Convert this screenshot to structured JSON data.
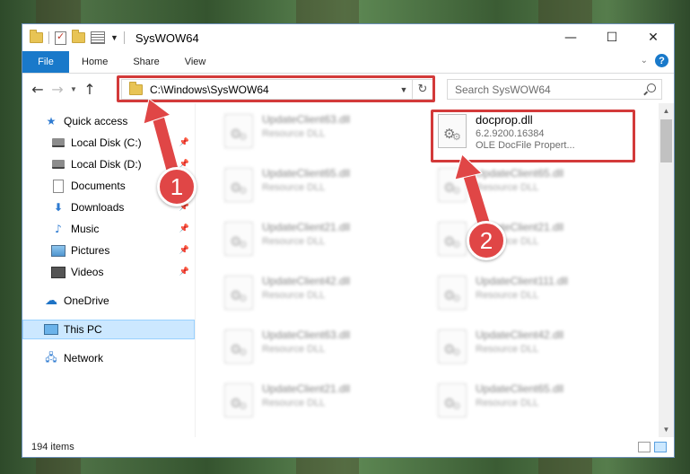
{
  "window": {
    "title": "SysWOW64",
    "controls": [
      "—",
      "☐",
      "✕"
    ]
  },
  "ribbon": {
    "tabs": [
      "File",
      "Home",
      "Share",
      "View"
    ],
    "help": "?"
  },
  "address": {
    "path": "C:\\Windows\\SysWOW64",
    "search_placeholder": "Search SysWOW64"
  },
  "sidebar": {
    "items": [
      {
        "label": "Quick access",
        "icon": "star-icon",
        "pinned": false
      },
      {
        "label": "Local Disk (C:)",
        "icon": "disk-icon",
        "pinned": true
      },
      {
        "label": "Local Disk (D:)",
        "icon": "disk-icon",
        "pinned": true
      },
      {
        "label": "Documents",
        "icon": "document-icon",
        "pinned": true
      },
      {
        "label": "Downloads",
        "icon": "download-icon",
        "pinned": true
      },
      {
        "label": "Music",
        "icon": "music-icon",
        "pinned": true
      },
      {
        "label": "Pictures",
        "icon": "pictures-icon",
        "pinned": true
      },
      {
        "label": "Videos",
        "icon": "video-icon",
        "pinned": true
      },
      {
        "label": "OneDrive",
        "icon": "cloud-icon",
        "pinned": false
      },
      {
        "label": "This PC",
        "icon": "computer-icon",
        "pinned": false,
        "selected": true
      },
      {
        "label": "Network",
        "icon": "network-icon",
        "pinned": false
      }
    ]
  },
  "files": {
    "left_column": [
      {
        "name": "UpdateClient63.dll",
        "type": "Resource DLL"
      },
      {
        "name": "UpdateClient65.dll",
        "type": "Resource DLL"
      },
      {
        "name": "UpdateClient21.dll",
        "type": "Resource DLL"
      },
      {
        "name": "UpdateClient42.dll",
        "type": "Resource DLL"
      },
      {
        "name": "UpdateClient63.dll",
        "type": "Resource DLL"
      },
      {
        "name": "UpdateClient21.dll",
        "type": "Resource DLL"
      }
    ],
    "highlighted": {
      "name": "docprop.dll",
      "version": "6.2.9200.16384",
      "description": "OLE DocFile Propert..."
    },
    "right_column": [
      {
        "name": "UpdateClient65.dll",
        "type": "Resource DLL"
      },
      {
        "name": "UpdateClient21.dll",
        "type": "Resource DLL"
      },
      {
        "name": "UpdateClient111.dll",
        "type": "Resource DLL"
      },
      {
        "name": "UpdateClient42.dll",
        "type": "Resource DLL"
      },
      {
        "name": "UpdateClient65.dll",
        "type": "Resource DLL"
      }
    ]
  },
  "status": {
    "item_count": "194 items"
  },
  "annotations": {
    "step1": "1",
    "step2": "2",
    "color": "#e04646"
  }
}
